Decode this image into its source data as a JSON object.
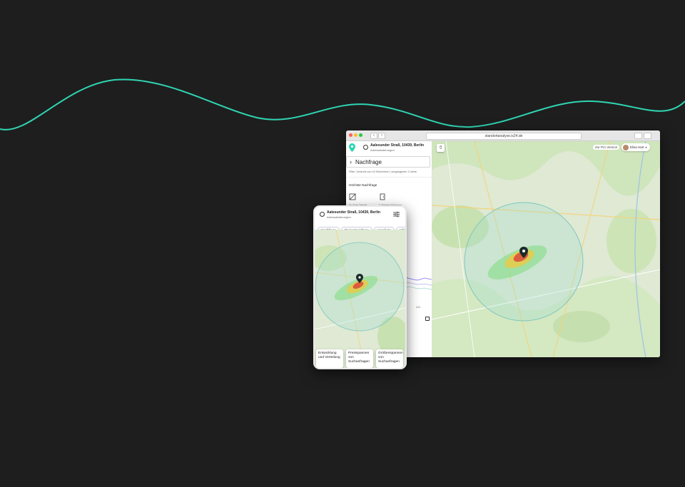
{
  "browser": {
    "url": "standortanalyse.is24.de",
    "back_icon": "chevron-left-icon",
    "forward_icon": "chevron-right-icon"
  },
  "sidebar": {
    "address": "Aalesunder Straß, 10439, Berlin",
    "address_sub": "Adressänderungen",
    "section_title": "Nachfrage",
    "filter_text": "Filter: Umkreis von 10 Kilometern | vergangenen 3 Jahre",
    "highest_demand": "Höchste Nachfrage",
    "demand_a_label": "Du Dant Tabelle",
    "demand_b_label": "2-Zimmer Wohnung",
    "legend_value": "1.0"
  },
  "map_header": {
    "pro_button": "Zur Pro Version",
    "user_name": "Elisa Hart"
  },
  "mobile": {
    "address": "Aalesunder Straß, 10439, Berlin",
    "address_sub": "Adressänderungen",
    "chips": [
      "Nachfrage",
      "Preisentwicklung",
      "Angebote",
      "Infrastruktur"
    ],
    "cards": [
      "Entwicklung und Verteilung",
      "Preisspannen von Suchanfragen",
      "Größenspannen von Suchanfragen"
    ]
  },
  "colors": {
    "background": "#1e1e1e",
    "wave": "#2fd5b3",
    "accent": "#2fd5b3",
    "heat_hot": "#d94a3a",
    "heat_mid": "#f0c93a",
    "map_green": "#cfe8b8"
  }
}
